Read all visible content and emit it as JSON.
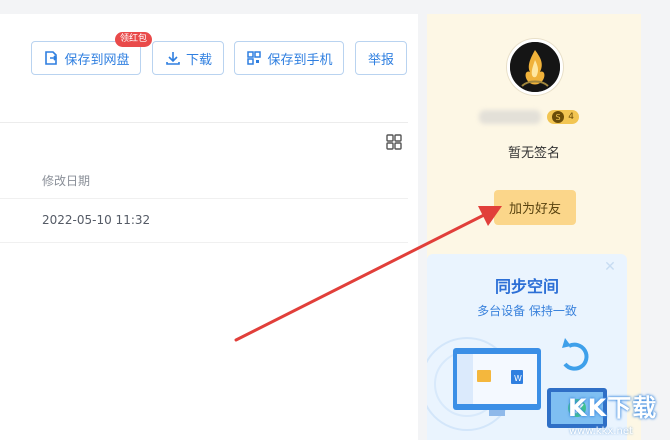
{
  "toolbar": {
    "save_to_disk": "保存到网盘",
    "hongbao_badge": "领红包",
    "download": "下载",
    "save_to_phone": "保存到手机",
    "report": "举报"
  },
  "file_list": {
    "col_modified": "修改日期",
    "rows": [
      {
        "modified": "2022-05-10 11:32"
      }
    ]
  },
  "profile": {
    "level_badge_letter": "S",
    "level_badge_number": "4",
    "signature": "暂无签名",
    "add_friend": "加为好友"
  },
  "promo": {
    "title": "同步空间",
    "subtitle": "多台设备 保持一致",
    "close_icon": "close-icon"
  },
  "watermark": {
    "brand": "KK下载",
    "url": "www.kkx.net"
  },
  "colors": {
    "primary": "#2f7fe0",
    "sidebar_bg": "#fdf7e5",
    "add_friend_bg": "#fbd68a",
    "arrow": "#e13f3a"
  }
}
